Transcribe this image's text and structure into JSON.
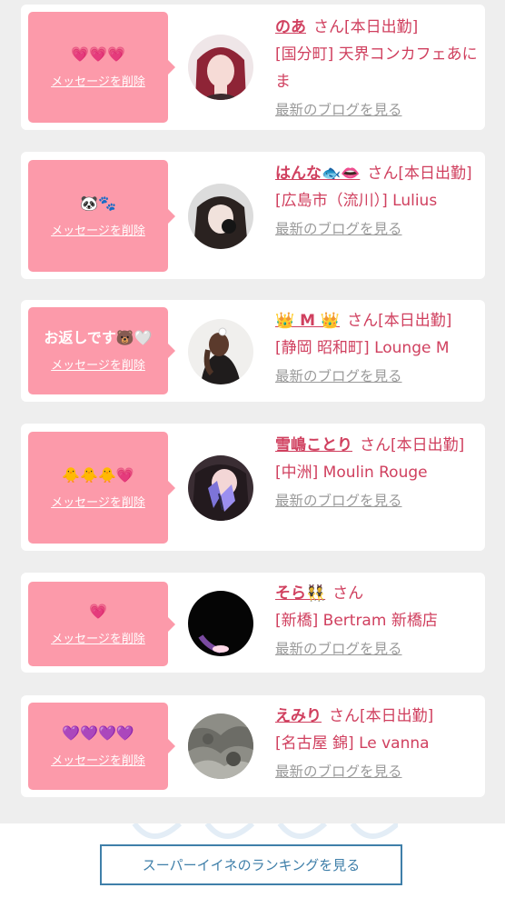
{
  "messages": [
    {
      "bubble_text": "💗💗💗",
      "delete_label": "メッセージを削除",
      "name": "のあ",
      "suffix": "さん[本日出勤]",
      "store": "[国分町] 天界コンカフェあにま",
      "blog_link": "最新のブログを見る"
    },
    {
      "bubble_text": "🐼🐾",
      "delete_label": "メッセージを削除",
      "name": "はんな🐟👄",
      "suffix": "さん[本日出勤]",
      "store": "[広島市（流川）] Lulius",
      "blog_link": "最新のブログを見る"
    },
    {
      "bubble_text": "お返しです🐻🤍",
      "delete_label": "メッセージを削除",
      "name": "👑 M 👑",
      "suffix": "さん[本日出勤]",
      "store": "[静岡 昭和町] Lounge M",
      "blog_link": "最新のブログを見る"
    },
    {
      "bubble_text": "🐥🐥🐥💗",
      "delete_label": "メッセージを削除",
      "name": "雪嶋ことり",
      "suffix": "さん[本日出勤]",
      "store": "[中洲] Moulin Rouge",
      "blog_link": "最新のブログを見る"
    },
    {
      "bubble_text": "💗",
      "delete_label": "メッセージを削除",
      "name": "そら👯",
      "suffix": "さん",
      "store": "[新橋] Bertram 新橋店",
      "blog_link": "最新のブログを見る"
    },
    {
      "bubble_text": "💜💜💜💜",
      "delete_label": "メッセージを削除",
      "name": "えみり",
      "suffix": "さん[本日出勤]",
      "store": "[名古屋 錦] Le vanna",
      "blog_link": "最新のブログを見る"
    }
  ],
  "footer": {
    "ranking_button": "スーパーイイネのランキングを見る"
  },
  "colors": {
    "accent_pink": "#fc9aaa",
    "name_red": "#d0405f",
    "link_gray": "#9a9a9a",
    "button_blue": "#3f7fa9",
    "background": "#eeeeee"
  }
}
